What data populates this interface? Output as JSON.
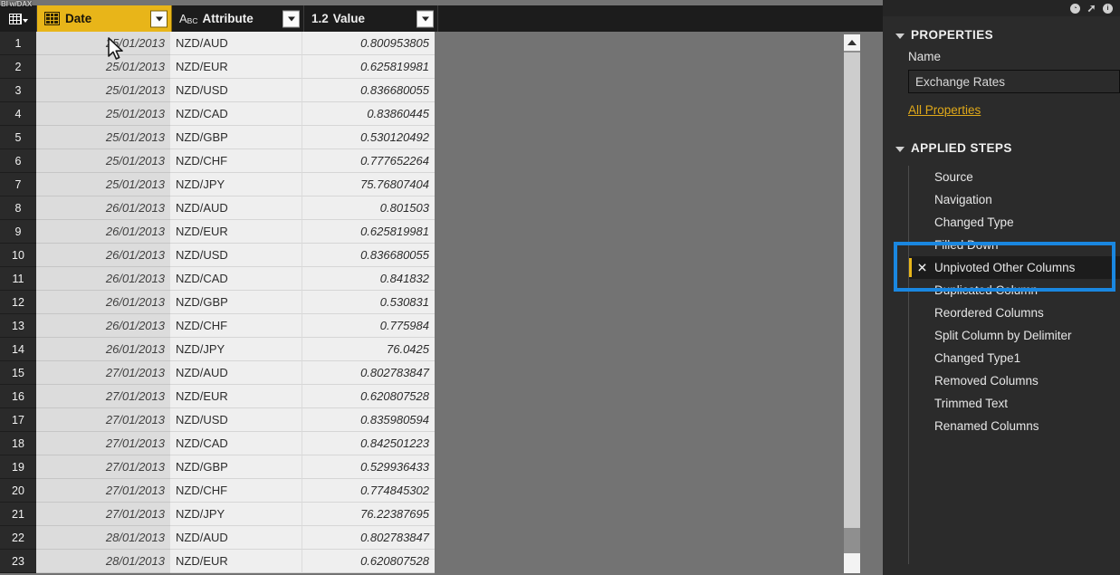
{
  "app": {
    "watermark": "BI w/DAX"
  },
  "titlebar": {
    "icons": [
      {
        "name": "history-icon",
        "glyph": "◔"
      },
      {
        "name": "share-arrow-icon",
        "glyph": "➚"
      },
      {
        "name": "info-icon",
        "glyph": "i"
      }
    ]
  },
  "grid": {
    "columns": [
      {
        "key": "rownum",
        "label": "",
        "type_icon": "row-number",
        "type_label": ""
      },
      {
        "key": "date",
        "label": "Date",
        "type_icon": "calendar-icon",
        "type_label": "Date"
      },
      {
        "key": "attribute",
        "label": "Attribute",
        "type_icon": "abc-icon",
        "type_label": "ABC"
      },
      {
        "key": "value",
        "label": "Value",
        "type_icon": "decimal-number-icon",
        "type_label": "1.2"
      }
    ],
    "filter_caret": "▼",
    "rows": [
      {
        "n": "1",
        "date": "25/01/2013",
        "attribute": "NZD/AUD",
        "value": "0.800953805"
      },
      {
        "n": "2",
        "date": "25/01/2013",
        "attribute": "NZD/EUR",
        "value": "0.625819981"
      },
      {
        "n": "3",
        "date": "25/01/2013",
        "attribute": "NZD/USD",
        "value": "0.836680055"
      },
      {
        "n": "4",
        "date": "25/01/2013",
        "attribute": "NZD/CAD",
        "value": "0.83860445"
      },
      {
        "n": "5",
        "date": "25/01/2013",
        "attribute": "NZD/GBP",
        "value": "0.530120492"
      },
      {
        "n": "6",
        "date": "25/01/2013",
        "attribute": "NZD/CHF",
        "value": "0.777652264"
      },
      {
        "n": "7",
        "date": "25/01/2013",
        "attribute": "NZD/JPY",
        "value": "75.76807404"
      },
      {
        "n": "8",
        "date": "26/01/2013",
        "attribute": "NZD/AUD",
        "value": "0.801503"
      },
      {
        "n": "9",
        "date": "26/01/2013",
        "attribute": "NZD/EUR",
        "value": "0.625819981"
      },
      {
        "n": "10",
        "date": "26/01/2013",
        "attribute": "NZD/USD",
        "value": "0.836680055"
      },
      {
        "n": "11",
        "date": "26/01/2013",
        "attribute": "NZD/CAD",
        "value": "0.841832"
      },
      {
        "n": "12",
        "date": "26/01/2013",
        "attribute": "NZD/GBP",
        "value": "0.530831"
      },
      {
        "n": "13",
        "date": "26/01/2013",
        "attribute": "NZD/CHF",
        "value": "0.775984"
      },
      {
        "n": "14",
        "date": "26/01/2013",
        "attribute": "NZD/JPY",
        "value": "76.0425"
      },
      {
        "n": "15",
        "date": "27/01/2013",
        "attribute": "NZD/AUD",
        "value": "0.802783847"
      },
      {
        "n": "16",
        "date": "27/01/2013",
        "attribute": "NZD/EUR",
        "value": "0.620807528"
      },
      {
        "n": "17",
        "date": "27/01/2013",
        "attribute": "NZD/USD",
        "value": "0.835980594"
      },
      {
        "n": "18",
        "date": "27/01/2013",
        "attribute": "NZD/CAD",
        "value": "0.842501223"
      },
      {
        "n": "19",
        "date": "27/01/2013",
        "attribute": "NZD/GBP",
        "value": "0.529936433"
      },
      {
        "n": "20",
        "date": "27/01/2013",
        "attribute": "NZD/CHF",
        "value": "0.774845302"
      },
      {
        "n": "21",
        "date": "27/01/2013",
        "attribute": "NZD/JPY",
        "value": "76.22387695"
      },
      {
        "n": "22",
        "date": "28/01/2013",
        "attribute": "NZD/AUD",
        "value": "0.802783847"
      },
      {
        "n": "23",
        "date": "28/01/2013",
        "attribute": "NZD/EUR",
        "value": "0.620807528"
      }
    ]
  },
  "query_settings": {
    "properties": {
      "header": "PROPERTIES",
      "name_label": "Name",
      "name_value": "Exchange Rates",
      "all_properties_link": "All Properties"
    },
    "applied_steps": {
      "header": "APPLIED STEPS",
      "delete_glyph": "✕",
      "steps": [
        {
          "label": "Source",
          "selected": false
        },
        {
          "label": "Navigation",
          "selected": false
        },
        {
          "label": "Changed Type",
          "selected": false
        },
        {
          "label": "Filled Down",
          "selected": false
        },
        {
          "label": "Unpivoted Other Columns",
          "selected": true
        },
        {
          "label": "Duplicated Column",
          "selected": false
        },
        {
          "label": "Reordered Columns",
          "selected": false
        },
        {
          "label": "Split Column by Delimiter",
          "selected": false
        },
        {
          "label": "Changed Type1",
          "selected": false
        },
        {
          "label": "Removed Columns",
          "selected": false
        },
        {
          "label": "Trimmed Text",
          "selected": false
        },
        {
          "label": "Renamed Columns",
          "selected": false
        }
      ]
    }
  },
  "annotation": {
    "highlight_color": "#1a87e0",
    "target_step": "Unpivoted Other Columns"
  },
  "colors": {
    "accent_yellow": "#e8b519",
    "panel_dark": "#2b2b2b",
    "grid_gray": "#737373",
    "highlight_blue": "#1a87e0"
  }
}
